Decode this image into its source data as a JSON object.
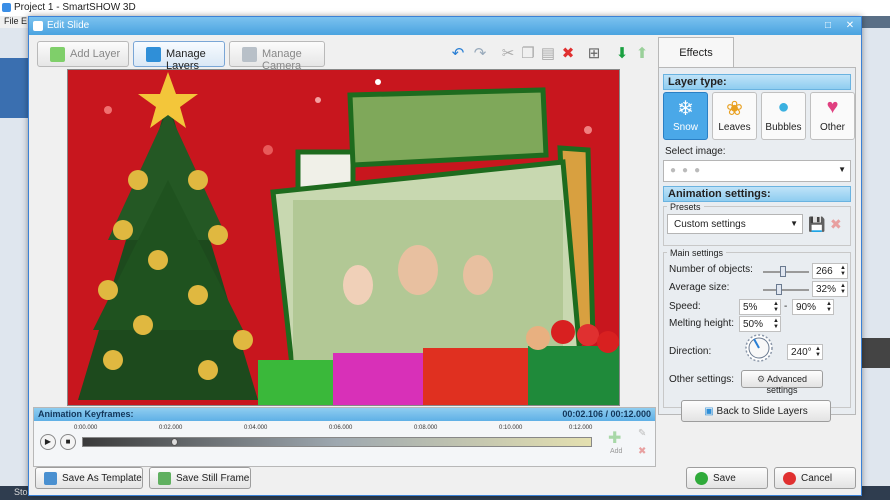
{
  "app": {
    "title": "Project 1 - SmartSHOW 3D",
    "menu": "File  E",
    "status": "Sto"
  },
  "dialog": {
    "title": "Edit Slide"
  },
  "toolbar": {
    "add_layer": "Add Layer",
    "manage_layers": "Manage Layers",
    "manage_camera": "Manage Camera"
  },
  "tabs": {
    "effects": "Effects"
  },
  "layer_type": {
    "header": "Layer type:",
    "items": [
      "Snow",
      "Leaves",
      "Bubbles",
      "Other"
    ],
    "selected": "Snow"
  },
  "select_image": {
    "label": "Select image:"
  },
  "animation_settings": {
    "header": "Animation settings:",
    "presets_label": "Presets",
    "preset_value": "Custom settings",
    "main_settings_label": "Main settings",
    "number_label": "Number of objects:",
    "number_value": "266",
    "number_fraction": 0.42,
    "size_label": "Average size:",
    "size_value": "32%",
    "size_fraction": 0.32,
    "speed_label": "Speed:",
    "speed_min": "5%",
    "speed_sep": "-",
    "speed_max": "90%",
    "melting_label": "Melting height:",
    "melting_value": "50%",
    "direction_label": "Direction:",
    "direction_value": "240°",
    "other_label": "Other settings:",
    "advanced_label": "Advanced settings"
  },
  "back_button": "Back to Slide Layers",
  "keyframes": {
    "title": "Animation Keyframes:",
    "time": "00:02.106 / 00:12.000",
    "ticks": [
      "0:00.000",
      "0:02.000",
      "0:04.000",
      "0:06.000",
      "0:08.000",
      "0:10.000",
      "0:12.000"
    ],
    "playhead_fraction": 0.175,
    "add_label": "Add"
  },
  "bottom": {
    "save_template": "Save As Template",
    "save_frame": "Save Still Frame",
    "save": "Save",
    "cancel": "Cancel"
  },
  "colors": {
    "accent": "#4aa8e8",
    "stage_red": "#c8161e",
    "photo_frame": "#1e6b1e"
  }
}
